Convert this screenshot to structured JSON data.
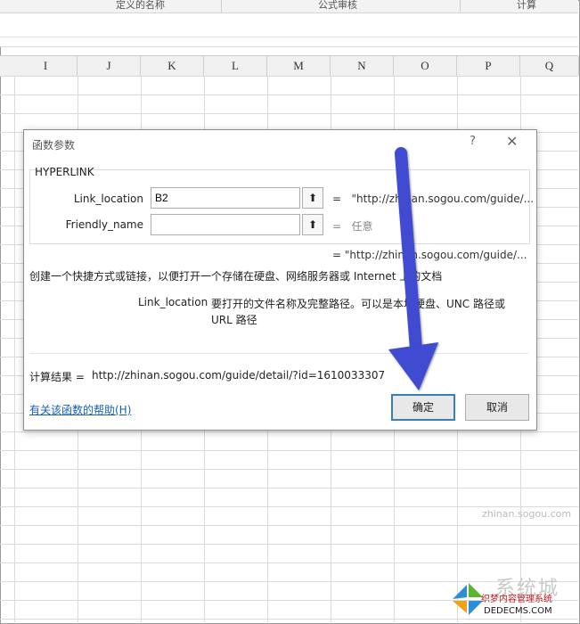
{
  "ribbon": {
    "groups": [
      "定义的名称",
      "公式审核",
      "计算"
    ]
  },
  "sheet": {
    "columns": [
      "I",
      "J",
      "K",
      "L",
      "M",
      "N",
      "O",
      "P",
      "Q"
    ],
    "bg_fragment": "zhinan.sogou.com"
  },
  "dialog": {
    "title": "函数参数",
    "help_glyph": "?",
    "close_glyph": "✕",
    "function_name": "HYPERLINK",
    "args": [
      {
        "label": "Link_location",
        "value": "B2",
        "equals": "=",
        "result": "\"http://zhinan.sogou.com/guide/..."
      },
      {
        "label": "Friendly_name",
        "value": "",
        "equals": "=",
        "result": "任意"
      }
    ],
    "overall_result_eq": "= \"http://zhinan.sogou.com/guide/...",
    "description": "创建一个快捷方式或链接，以便打开一个存储在硬盘、网络服务器或  Internet 上的文档",
    "param_name": "Link_location",
    "param_description": "要打开的文件名称及完整路径。可以是本地硬盘、UNC 路径或 URL 路径",
    "result_label": "计算结果 =",
    "result_value": "http://zhinan.sogou.com/guide/detail/?id=1610033307",
    "help_link": "有关该函数的帮助(H)",
    "ok_label": "确定",
    "cancel_label": "取消",
    "collapse_glyph": "⬆"
  },
  "annotation": {
    "arrow_color": "#3f4bd1"
  },
  "watermark": {
    "big_text": "系统城",
    "sub_text": "织梦内容管理系统",
    "url_text": "DEDECMS.COM"
  }
}
